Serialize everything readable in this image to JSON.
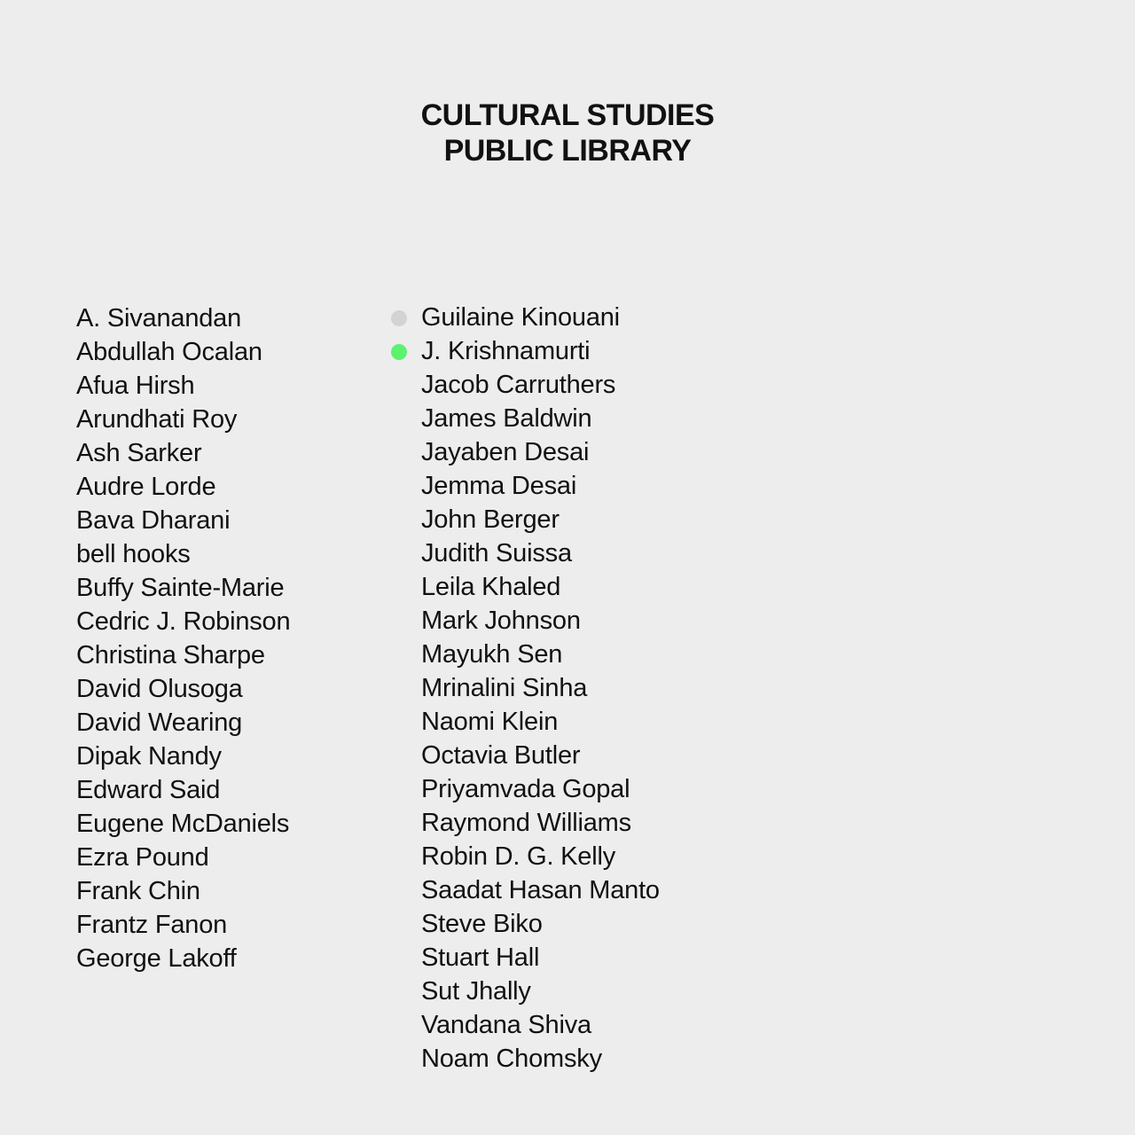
{
  "header": {
    "title_line1": "CULTURAL STUDIES",
    "title_line2": "PUBLIC LIBRARY"
  },
  "authors_left": [
    "A. Sivanandan",
    "Abdullah Ocalan",
    "Afua Hirsh",
    "Arundhati Roy",
    "Ash Sarker",
    "Audre Lorde",
    "Bava Dharani",
    "bell hooks",
    "Buffy Sainte-Marie",
    "Cedric J. Robinson",
    "Christina Sharpe",
    "David Olusoga",
    "David Wearing",
    "Dipak Nandy",
    "Edward Said",
    "Eugene McDaniels",
    "Ezra Pound",
    "Frank Chin",
    "Frantz Fanon",
    "George Lakoff"
  ],
  "authors_right": [
    "Guilaine Kinouani",
    "J. Krishnamurti",
    "Jacob Carruthers",
    "James Baldwin",
    "Jayaben Desai",
    "Jemma Desai",
    "John Berger",
    "Judith Suissa",
    "Leila Khaled",
    "Mark Johnson",
    "Mayukh Sen",
    "Mrinalini Sinha",
    "Naomi Klein",
    "Octavia Butler",
    "Priyamvada Gopal",
    "Raymond Williams",
    "Robin D. G. Kelly",
    "Saadat Hasan Manto",
    "Steve Biko",
    "Stuart Hall",
    "Sut Jhally",
    "Vandana Shiva",
    "Noam Chomsky"
  ],
  "indicators": {
    "Guilaine Kinouani": "#d3d3d3",
    "J. Krishnamurti": "#5cf26e"
  },
  "colors": {
    "background": "#ededed",
    "text": "#111111",
    "indicator_grey": "#d3d3d3",
    "indicator_green": "#5cf26e"
  }
}
